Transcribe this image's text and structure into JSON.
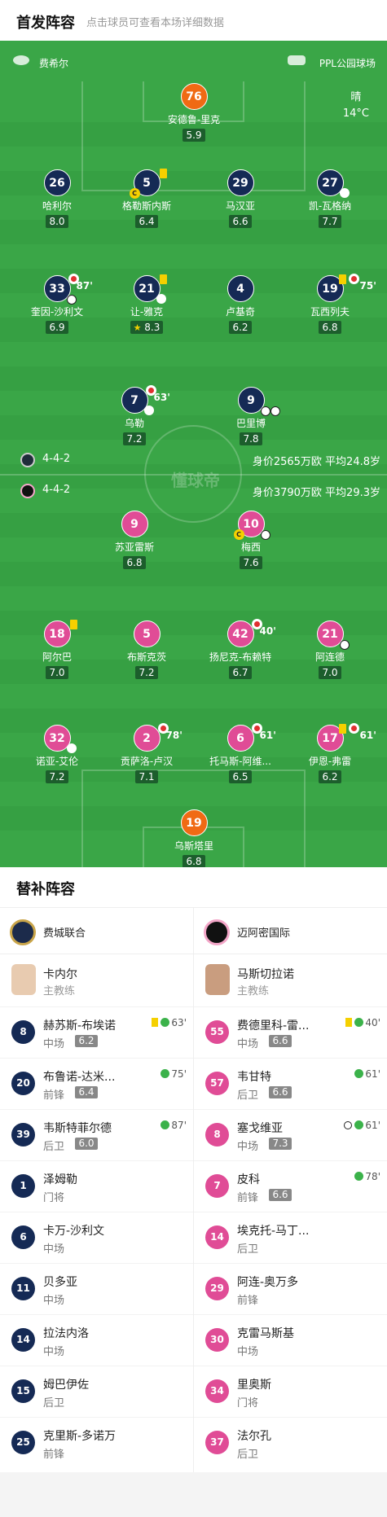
{
  "header": {
    "title": "首发阵容",
    "subtitle": "点击球员可查看本场详细数据"
  },
  "pitch": {
    "home_team": "费希尔",
    "venue": "PPL公园球场",
    "weather": "晴",
    "temperature": "14°C",
    "home_formation": "4-4-2",
    "home_value": "身价2565万欧 平均24.8岁",
    "away_formation": "4-4-2",
    "away_value": "身价3790万欧 平均29.3岁",
    "watermark": "懂球帝"
  },
  "home_players": [
    {
      "num": "76",
      "name": "安德鲁-里克",
      "rating": "5.9"
    },
    {
      "num": "26",
      "name": "哈利尔",
      "rating": "8.0"
    },
    {
      "num": "5",
      "name": "格勒斯内斯",
      "rating": "6.4"
    },
    {
      "num": "29",
      "name": "马汉亚",
      "rating": "6.6"
    },
    {
      "num": "27",
      "name": "凯-瓦格纳",
      "rating": "7.7"
    },
    {
      "num": "33",
      "name": "奎因-沙利文",
      "rating": "6.9",
      "minute": "87'"
    },
    {
      "num": "21",
      "name": "让-雅克",
      "rating": "8.3"
    },
    {
      "num": "4",
      "name": "卢基奇",
      "rating": "6.2"
    },
    {
      "num": "19",
      "name": "瓦西列夫",
      "rating": "6.8",
      "minute": "75'"
    },
    {
      "num": "7",
      "name": "乌勒",
      "rating": "7.2",
      "minute": "63'"
    },
    {
      "num": "9",
      "name": "巴里博",
      "rating": "7.8"
    }
  ],
  "away_players": [
    {
      "num": "9",
      "name": "苏亚雷斯",
      "rating": "6.8"
    },
    {
      "num": "10",
      "name": "梅西",
      "rating": "7.6"
    },
    {
      "num": "18",
      "name": "阿尔巴",
      "rating": "7.0"
    },
    {
      "num": "5",
      "name": "布斯克茨",
      "rating": "7.2"
    },
    {
      "num": "42",
      "name": "扬尼克-布赖特",
      "rating": "6.7",
      "minute": "40'"
    },
    {
      "num": "21",
      "name": "阿连德",
      "rating": "7.0"
    },
    {
      "num": "32",
      "name": "诺亚-艾伦",
      "rating": "7.2"
    },
    {
      "num": "2",
      "name": "贡萨洛-卢汉",
      "rating": "7.1",
      "minute": "78'"
    },
    {
      "num": "6",
      "name": "托马斯-阿维...",
      "rating": "6.5",
      "minute": "61'"
    },
    {
      "num": "17",
      "name": "伊恩-弗雷",
      "rating": "6.2",
      "minute": "61'"
    },
    {
      "num": "19",
      "name": "乌斯塔里",
      "rating": "6.8"
    }
  ],
  "subs": {
    "title": "替补阵容",
    "home": {
      "team": "费城联合",
      "coach": {
        "name": "卡内尔",
        "role": "主教练"
      },
      "players": [
        {
          "num": "8",
          "name": "赫苏斯-布埃诺",
          "pos": "中场",
          "rating": "6.2",
          "event": "63'"
        },
        {
          "num": "20",
          "name": "布鲁诺-达米...",
          "pos": "前锋",
          "rating": "6.4",
          "event": "75'"
        },
        {
          "num": "39",
          "name": "韦斯特菲尔德",
          "pos": "后卫",
          "rating": "6.0",
          "event": "87'"
        },
        {
          "num": "1",
          "name": "泽姆勒",
          "pos": "门将"
        },
        {
          "num": "6",
          "name": "卡万-沙利文",
          "pos": "中场"
        },
        {
          "num": "11",
          "name": "贝多亚",
          "pos": "中场"
        },
        {
          "num": "14",
          "name": "拉法内洛",
          "pos": "中场"
        },
        {
          "num": "15",
          "name": "姆巴伊佐",
          "pos": "后卫"
        },
        {
          "num": "25",
          "name": "克里斯-多诺万",
          "pos": "前锋"
        }
      ]
    },
    "away": {
      "team": "迈阿密国际",
      "coach": {
        "name": "马斯切拉诺",
        "role": "主教练"
      },
      "players": [
        {
          "num": "55",
          "name": "费德里科-雷...",
          "pos": "中场",
          "rating": "6.6",
          "event": "40'"
        },
        {
          "num": "57",
          "name": "韦甘特",
          "pos": "后卫",
          "rating": "6.6",
          "event": "61'"
        },
        {
          "num": "8",
          "name": "塞戈维亚",
          "pos": "中场",
          "rating": "7.3",
          "event": "61'"
        },
        {
          "num": "7",
          "name": "皮科",
          "pos": "前锋",
          "rating": "6.6",
          "event": "78'"
        },
        {
          "num": "14",
          "name": "埃克托-马丁...",
          "pos": "后卫"
        },
        {
          "num": "29",
          "name": "阿连-奥万多",
          "pos": "前锋"
        },
        {
          "num": "30",
          "name": "克雷马斯基",
          "pos": "中场"
        },
        {
          "num": "34",
          "name": "里奥斯",
          "pos": "门将"
        },
        {
          "num": "37",
          "name": "法尔孔",
          "pos": "后卫"
        }
      ]
    }
  },
  "colors": {
    "pitch": "#3aa647",
    "home": "#152a55",
    "away": "#e04c96",
    "gk": "#f06a14"
  }
}
